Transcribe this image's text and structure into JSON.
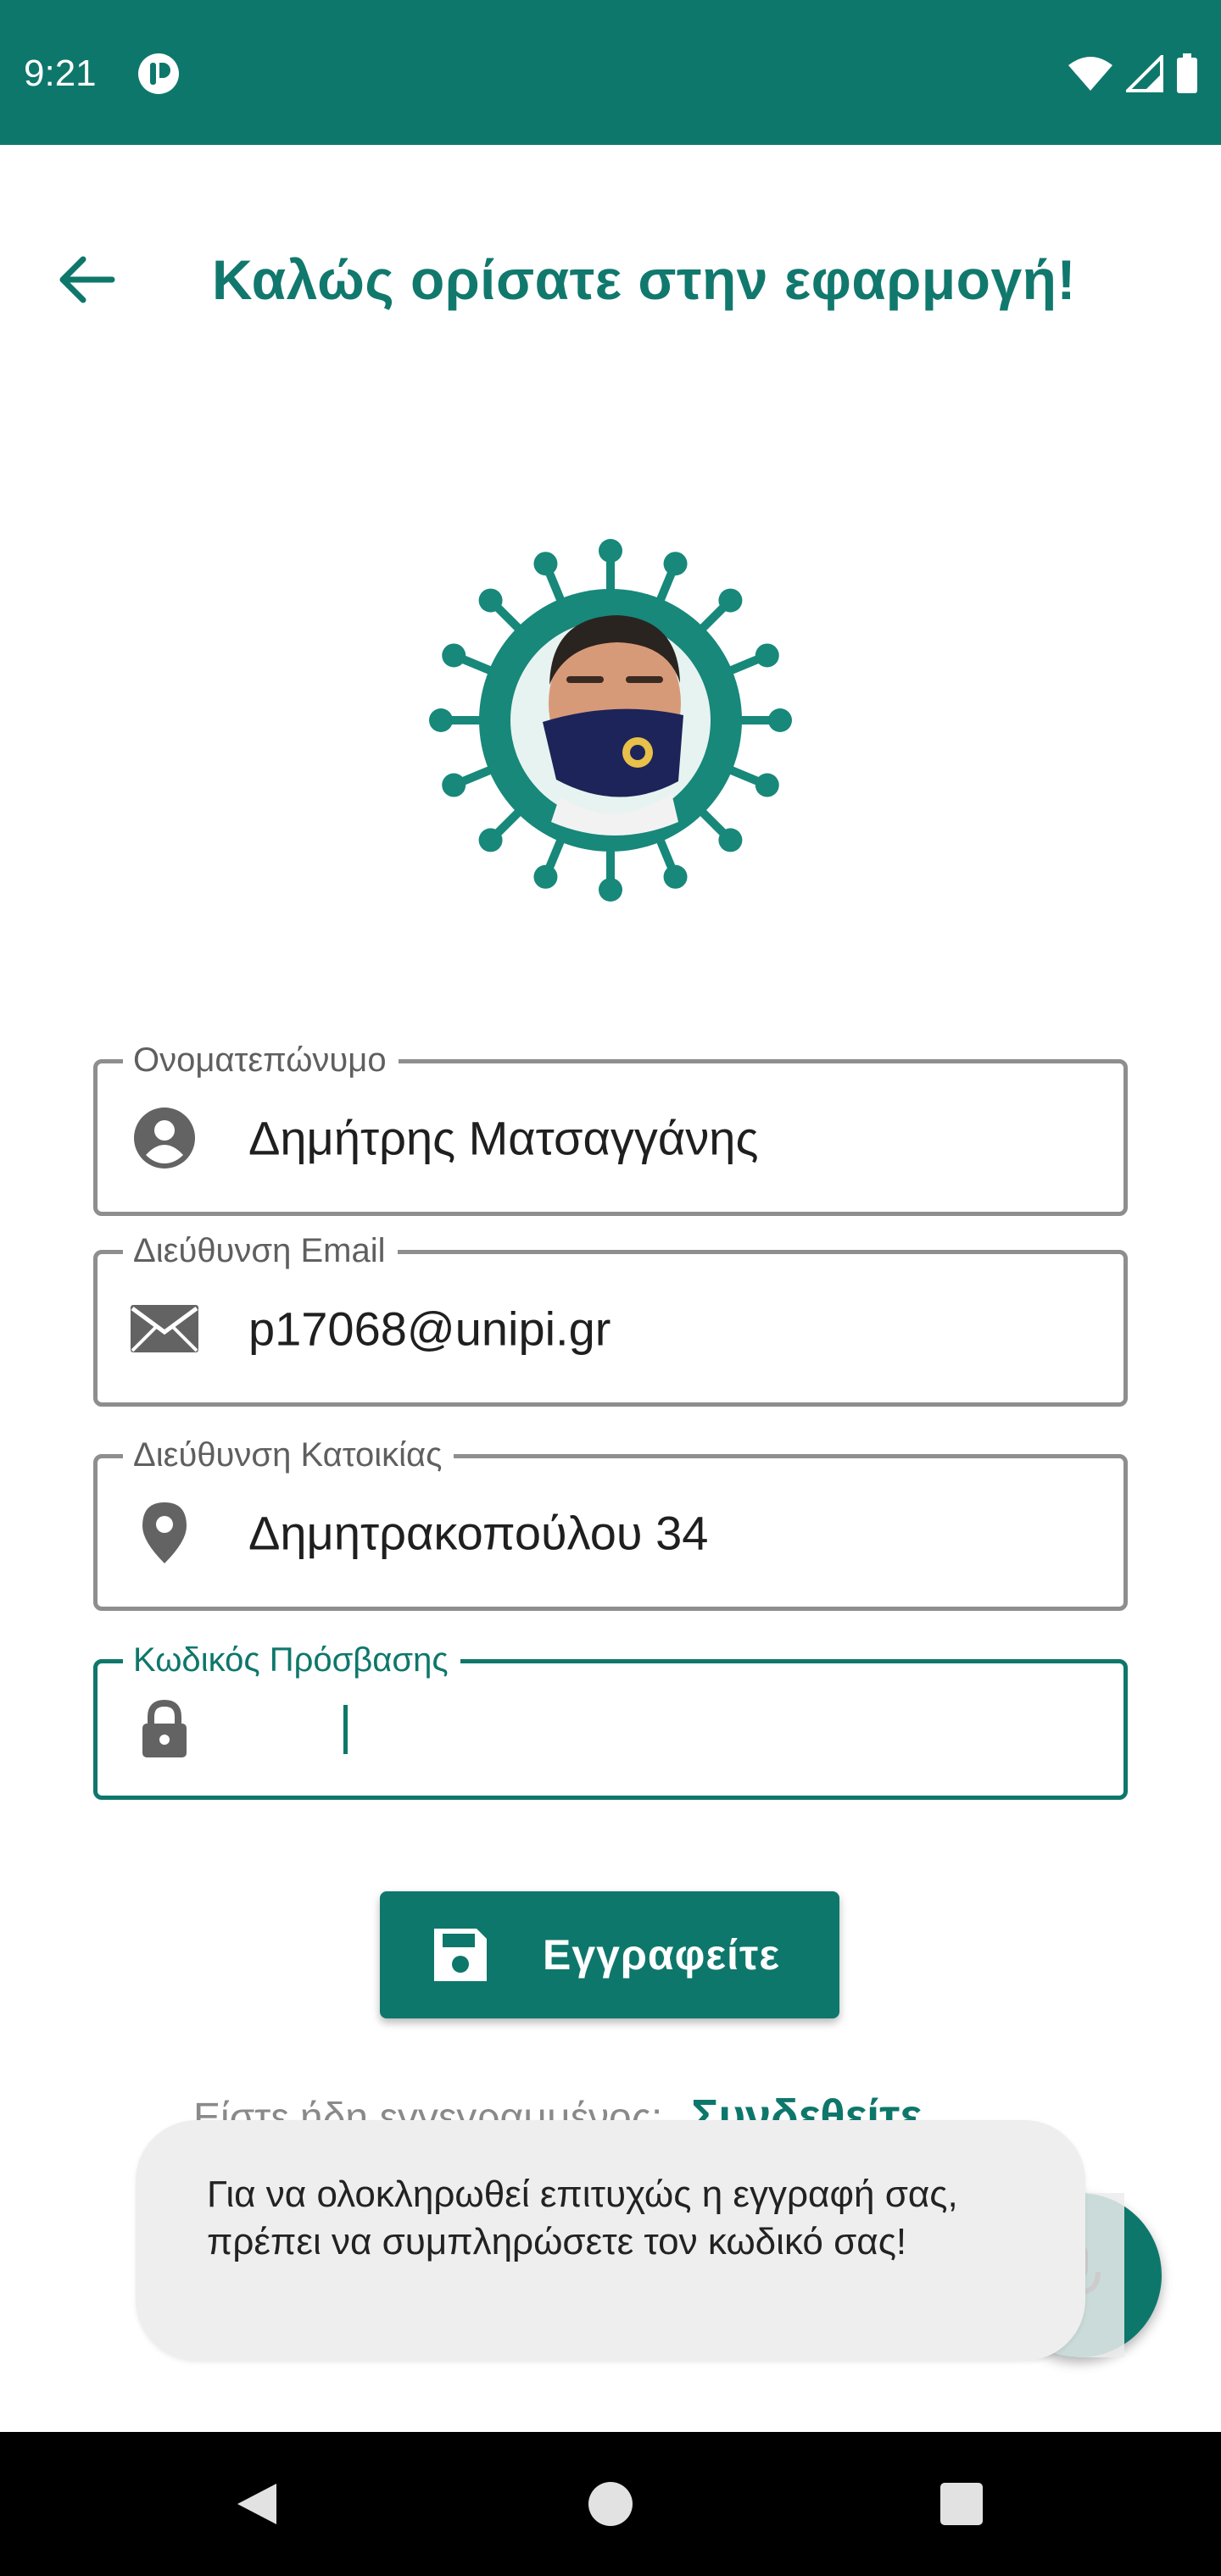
{
  "status_bar": {
    "time": "9:21",
    "icons": [
      "app-notification-icon",
      "wifi-icon",
      "cell-signal-icon",
      "battery-icon"
    ]
  },
  "app_bar": {
    "title": "Καλώς ορίσατε στην εφαρμογή!",
    "back_icon": "arrow-back-icon"
  },
  "form": {
    "fullname": {
      "label": "Ονοματεπώνυμο",
      "value": "Δημήτρης Ματσαγγάνης",
      "icon": "account-circle-icon"
    },
    "email": {
      "label": "Διεύθυνση Email",
      "value": "p17068@unipi.gr",
      "icon": "mail-icon"
    },
    "address": {
      "label": "Διεύθυνση Κατοικίας",
      "value": "Δημητρακοπούλου 34",
      "icon": "location-pin-icon"
    },
    "password": {
      "label": "Κωδικός Πρόσβασης",
      "value": "",
      "icon": "lock-icon"
    }
  },
  "register_button": {
    "label": "Εγγραφείτε",
    "icon": "save-icon"
  },
  "login_prompt": {
    "question": "Είστε ήδη εγγεγραμμένος;",
    "link": "Συνδεθείτε"
  },
  "toast": {
    "message": "Για να ολοκληρωθεί επιτυχώς η εγγραφή σας, πρέπει να συμπληρώσετε τον κωδικό σας!"
  },
  "fab": {
    "icon": "microphone-icon"
  },
  "colors": {
    "primary": "#0e776b",
    "outline": "#8e8e8e",
    "toast_bg": "#eeeeee"
  }
}
